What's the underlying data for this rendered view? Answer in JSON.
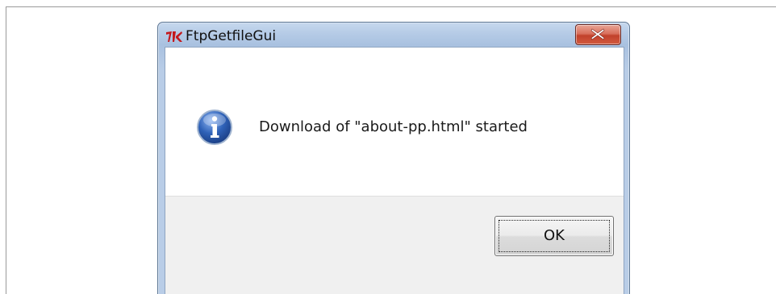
{
  "window": {
    "title": "FtpGetfileGui",
    "app_icon": "tk-feather-icon",
    "close_icon": "close-icon"
  },
  "message": {
    "icon": "info-icon",
    "text": "Download of \"about-pp.html\" started"
  },
  "buttons": {
    "ok_label": "OK"
  },
  "colors": {
    "close_button": "#c94a33",
    "info_icon_blue": "#2f62b8",
    "button_area": "#f0f0f0"
  }
}
